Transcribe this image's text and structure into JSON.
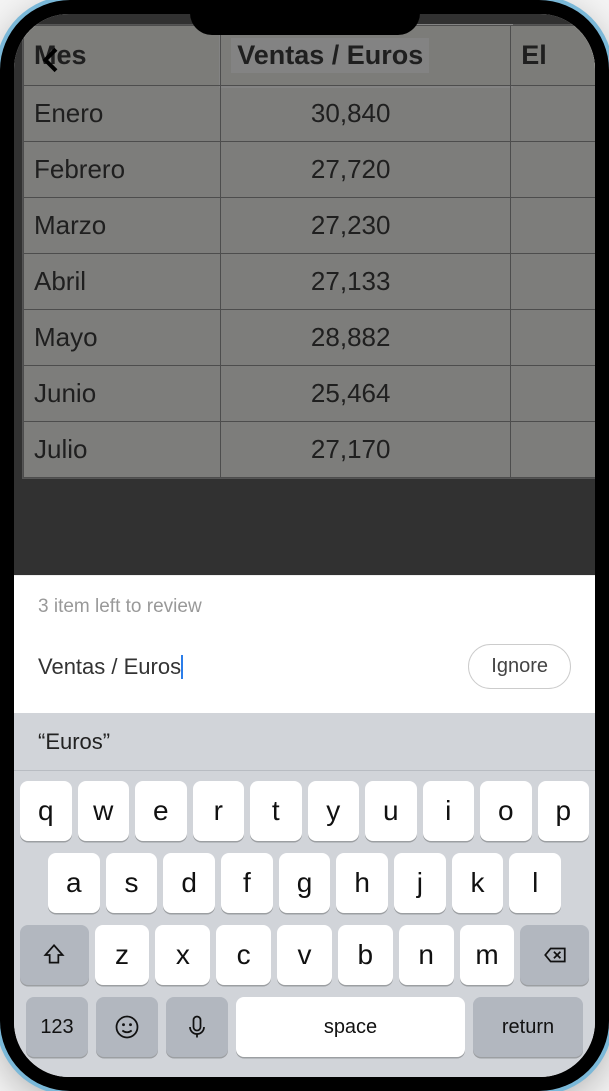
{
  "table": {
    "headers": {
      "col1": "Mes",
      "col2": "Ventas / Euros",
      "col3": "El"
    },
    "rows": [
      {
        "month": "Enero",
        "value": "30,840"
      },
      {
        "month": "Febrero",
        "value": "27,720"
      },
      {
        "month": "Marzo",
        "value": "27,230"
      },
      {
        "month": "Abril",
        "value": "27,133"
      },
      {
        "month": "Mayo",
        "value": "28,882"
      },
      {
        "month": "Junio",
        "value": "25,464"
      },
      {
        "month": "Julio",
        "value": "27,170"
      }
    ]
  },
  "review": {
    "status": "3 item left to review",
    "input_value": "Ventas / Euros",
    "ignore_label": "Ignore"
  },
  "keyboard": {
    "suggestion": "“Euros”",
    "rows": {
      "r1": [
        "q",
        "w",
        "e",
        "r",
        "t",
        "y",
        "u",
        "i",
        "o",
        "p"
      ],
      "r2": [
        "a",
        "s",
        "d",
        "f",
        "g",
        "h",
        "j",
        "k",
        "l"
      ],
      "r3": [
        "z",
        "x",
        "c",
        "v",
        "b",
        "n",
        "m"
      ]
    },
    "numbers_label": "123",
    "space_label": "space",
    "return_label": "return"
  }
}
